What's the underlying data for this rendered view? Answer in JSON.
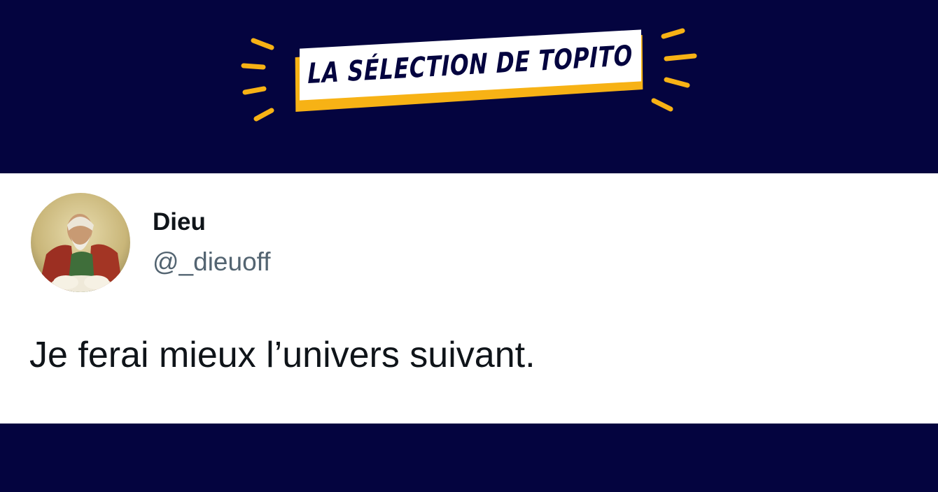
{
  "banner": {
    "title": "LA SÉLECTION DE TOPITO",
    "colors": {
      "background": "#04043f",
      "accent": "#f7b215",
      "badge": "#ffffff"
    }
  },
  "tweet": {
    "author_name": "Dieu",
    "author_handle": "@_dieuoff",
    "text": "Je ferai mieux l’univers suivant.",
    "avatar": "god-painting-avatar"
  }
}
